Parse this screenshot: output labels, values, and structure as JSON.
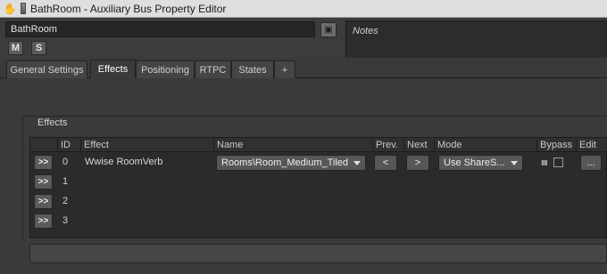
{
  "window": {
    "title": "BathRoom - Auxiliary Bus Property Editor"
  },
  "header": {
    "object_name": "BathRoom",
    "mute_label": "M",
    "solo_label": "S",
    "notes_placeholder": "Notes"
  },
  "tabs": [
    {
      "label": "General Settings",
      "active": false
    },
    {
      "label": "Effects",
      "active": true
    },
    {
      "label": "Positioning",
      "active": false
    },
    {
      "label": "RTPC",
      "active": false
    },
    {
      "label": "States",
      "active": false
    },
    {
      "label": "+",
      "active": false
    }
  ],
  "effects_group": {
    "label": "Effects",
    "columns": [
      "ID",
      "Effect",
      "Name",
      "Prev.",
      "Next",
      "Mode",
      "Bypass",
      "Edit"
    ],
    "rows": [
      {
        "arrow": ">>",
        "id": "0",
        "effect": "Wwise RoomVerb",
        "name": "Rooms\\Room_Medium_Tiled",
        "prev": "<",
        "next": ">",
        "mode": "Use ShareS...",
        "bypass_checked": false,
        "edit": "..."
      },
      {
        "arrow": ">>",
        "id": "1"
      },
      {
        "arrow": ">>",
        "id": "2"
      },
      {
        "arrow": ">>",
        "id": "3"
      }
    ]
  },
  "icons": {
    "title_icon": "hand-icon",
    "bus_icon": "aux-bus-icon",
    "link_icon": "link-icon",
    "bypass_icon": "bypass-icon"
  }
}
